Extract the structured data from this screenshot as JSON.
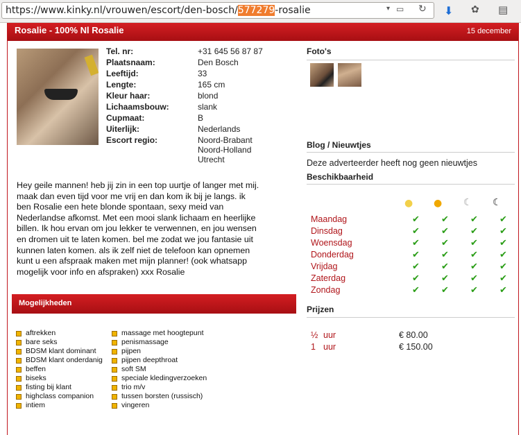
{
  "browser": {
    "url_prefix": "https://www.kinky.nl/vrouwen/escort/den-bosch/",
    "url_highlight": "577279",
    "url_suffix": "-rosalie"
  },
  "header": {
    "title": "Rosalie - 100% Nl Rosalie",
    "date": "15 december"
  },
  "profile": {
    "fields": [
      {
        "label": "Tel. nr:",
        "value": "+31 645 56 87 87"
      },
      {
        "label": "Plaatsnaam:",
        "value": "Den Bosch"
      },
      {
        "label": "Leeftijd:",
        "value": "33"
      },
      {
        "label": "Lengte:",
        "value": "165 cm"
      },
      {
        "label": "Kleur haar:",
        "value": "blond"
      },
      {
        "label": "Lichaamsbouw:",
        "value": "slank"
      },
      {
        "label": "Cupmaat:",
        "value": "B"
      },
      {
        "label": "Uiterlijk:",
        "value": "Nederlands"
      },
      {
        "label": "Escort regio:",
        "value": "Noord-Brabant"
      }
    ],
    "region_extra": [
      "Noord-Holland",
      "Utrecht"
    ]
  },
  "description": "Hey geile mannen! heb jij zin in een top uurtje of langer met mij. maak dan even tijd voor me vrij en dan kom ik bij je langs. ik ben Rosalie een hete blonde spontaan, sexy meid van Nederlandse afkomst. Met een mooi slank lichaam en heerlijke billen. Ik hou ervan om jou lekker te verwennen, en jou wensen en dromen uit te laten komen. bel me zodat we jou fantasie uit kunnen laten komen. als ik zelf niet de telefoon kan opnemen kunt u een afspraak maken met mijn planner! (ook whatsapp mogelijk voor info en afspraken) xxx Rosalie",
  "mogelijkheden": {
    "title": "Mogelijkheden",
    "col1": [
      "aftrekken",
      "bare seks",
      "BDSM klant dominant",
      "BDSM klant onderdanig",
      "beffen",
      "biseks",
      "fisting bij klant",
      "highclass companion",
      "intiem"
    ],
    "col2": [
      "massage met hoogtepunt",
      "penismassage",
      "pijpen",
      "pijpen deepthroat",
      "soft SM",
      "speciale kledingverzoeken",
      "trio m/v",
      "tussen borsten (russisch)",
      "vingeren"
    ]
  },
  "fotos": {
    "title": "Foto's",
    "count": 2
  },
  "blog": {
    "title": "Blog / Nieuwtjes",
    "text": "Deze adverteerder heeft nog geen nieuwtjes"
  },
  "availability": {
    "title": "Beschikbaarheid",
    "periods": [
      "morning-sun-icon",
      "afternoon-sun-icon",
      "evening-moon-icon",
      "night-moon-icon"
    ],
    "days": [
      "Maandag",
      "Dinsdag",
      "Woensdag",
      "Donderdag",
      "Vrijdag",
      "Zaterdag",
      "Zondag"
    ]
  },
  "prices": {
    "title": "Prijzen",
    "rows": [
      {
        "amount": "½",
        "unit": "uur",
        "price": "€ 80.00"
      },
      {
        "amount": "1",
        "unit": "uur",
        "price": "€ 150.00"
      }
    ]
  },
  "colors": {
    "brand_red": "#c0161d",
    "check_green": "#2a9d16",
    "bullet_orange": "#f0b400"
  }
}
